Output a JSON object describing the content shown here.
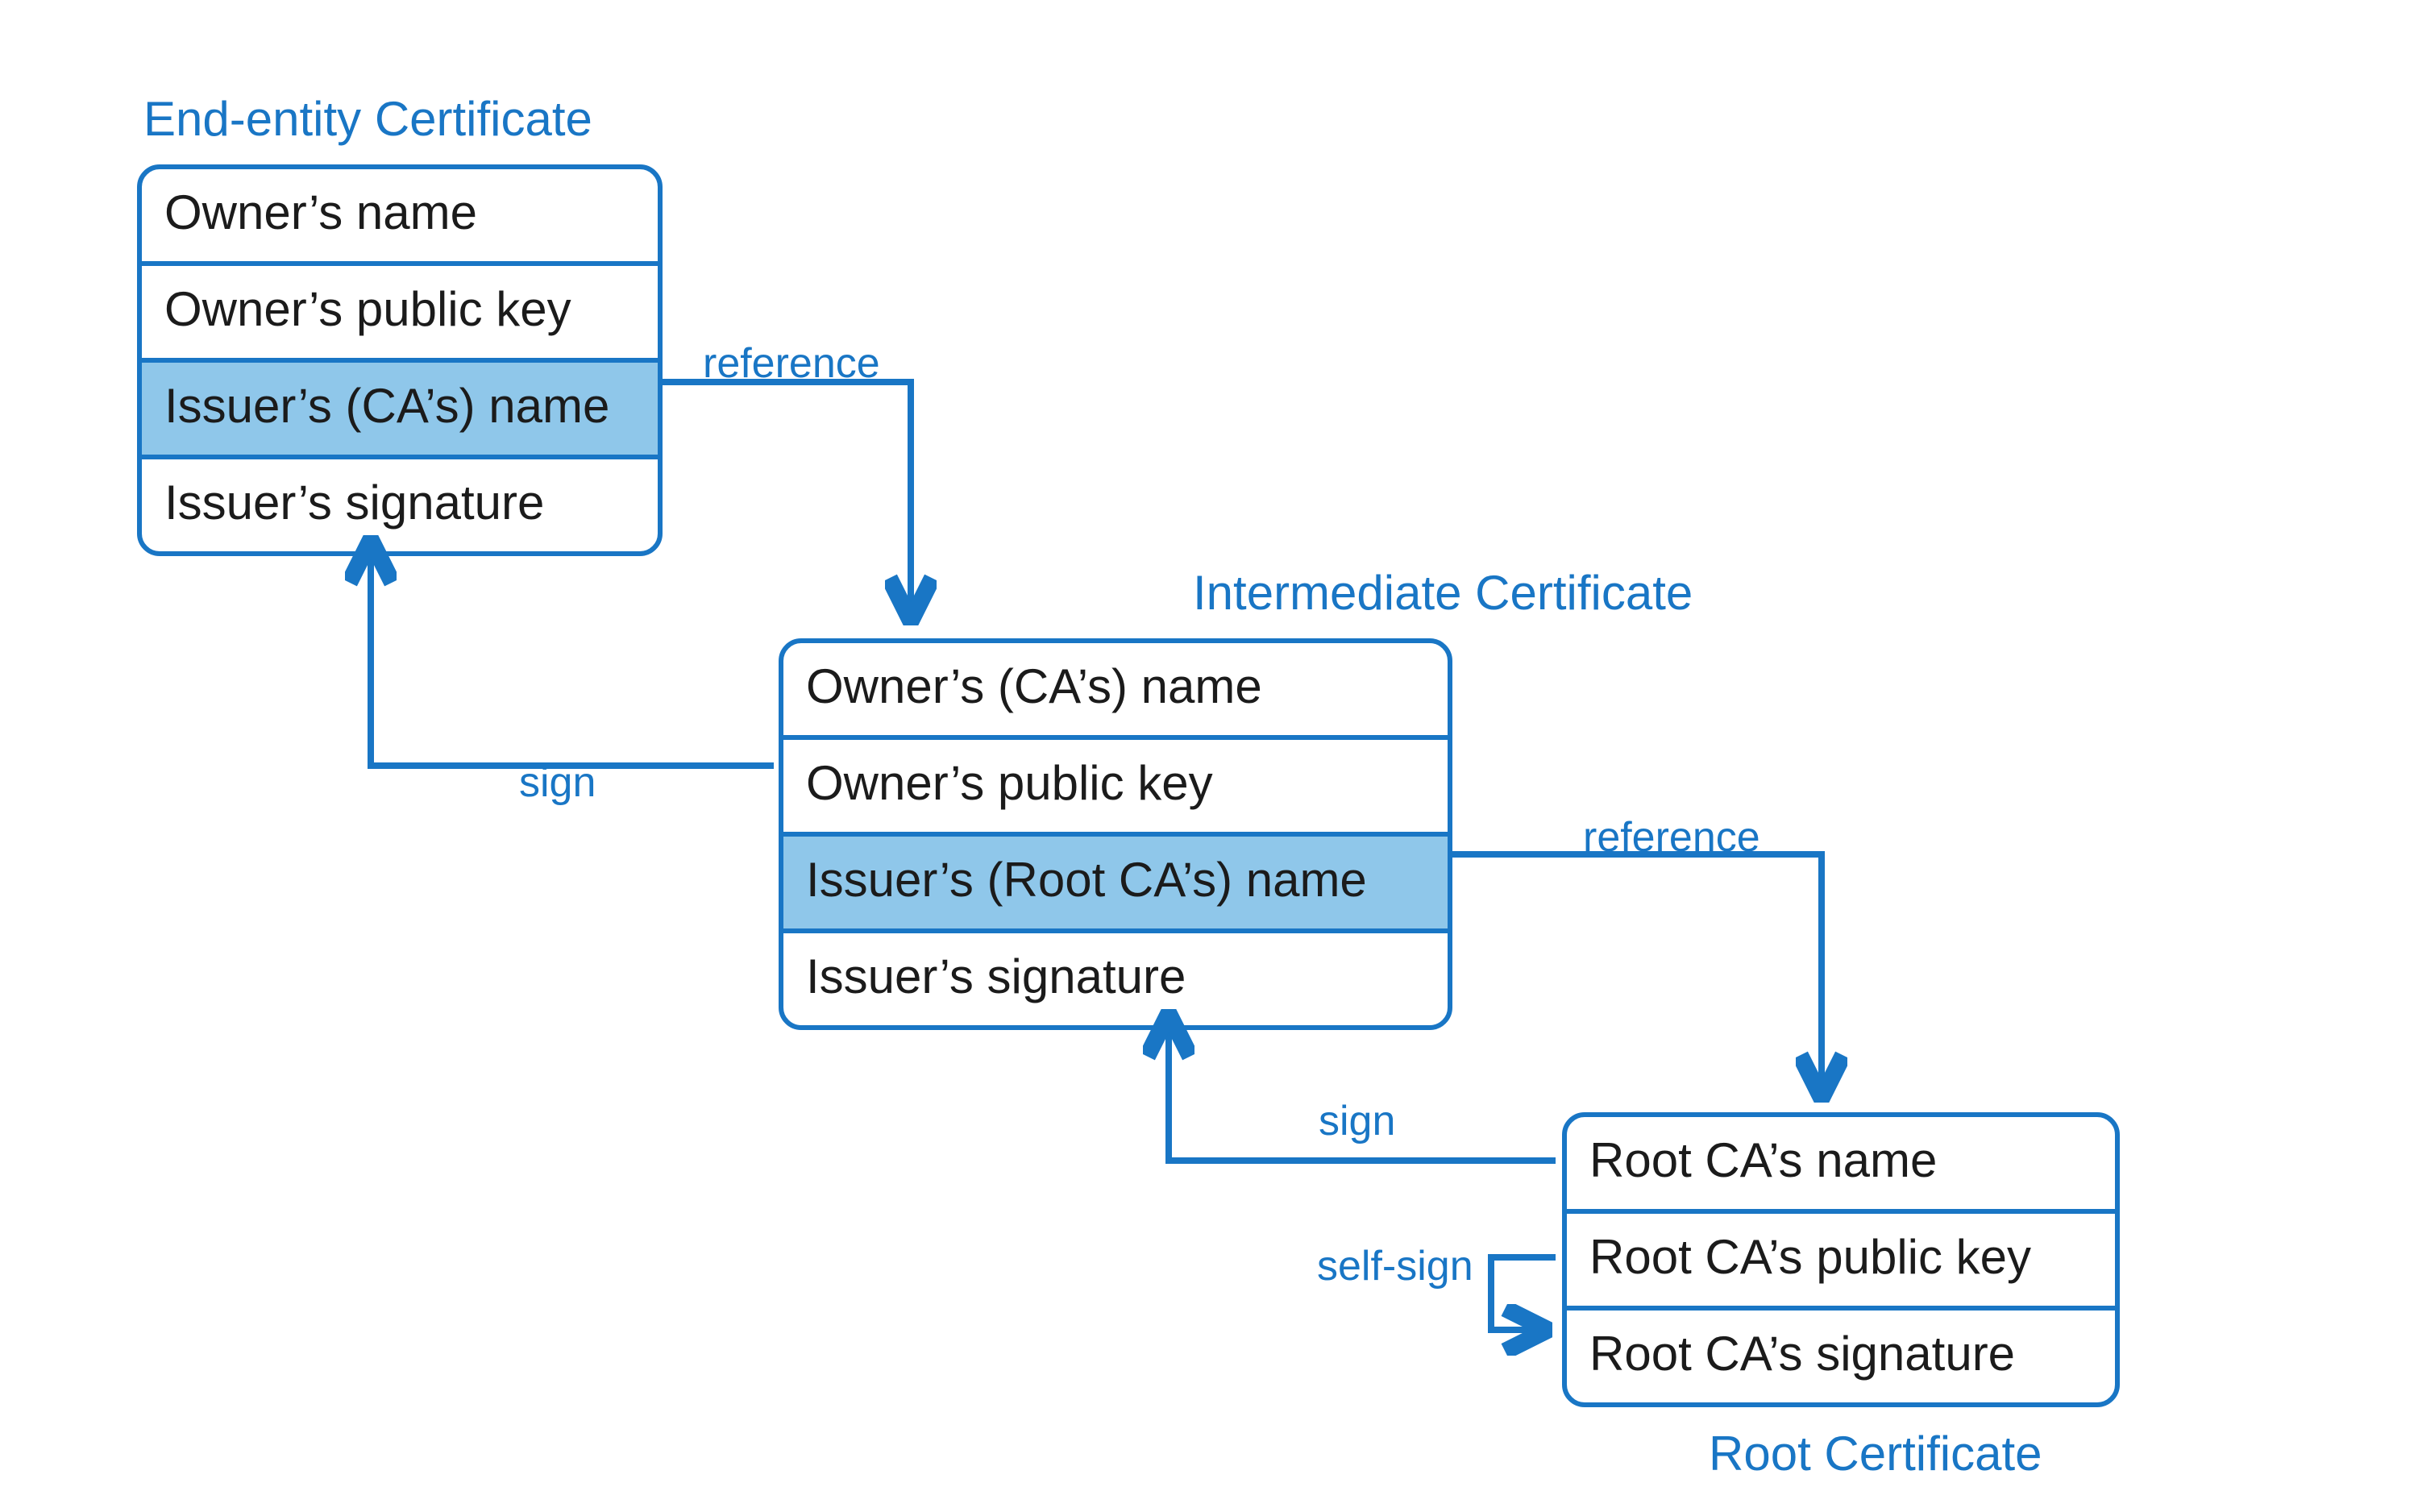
{
  "colors": {
    "accent": "#1976c5",
    "highlight": "#8fc7ea",
    "text": "#1b1b1b"
  },
  "certificates": {
    "end_entity": {
      "title": "End-entity Certificate",
      "rows": [
        "Owner’s name",
        "Owner’s public key",
        "Issuer’s (CA’s) name",
        "Issuer’s signature"
      ],
      "highlight_index": 2
    },
    "intermediate": {
      "title": "Intermediate Certificate",
      "rows": [
        "Owner’s (CA’s) name",
        "Owner’s public key",
        "Issuer’s (Root CA’s) name",
        "Issuer’s signature"
      ],
      "highlight_index": 2
    },
    "root": {
      "title": "Root Certificate",
      "rows": [
        "Root CA’s name",
        "Root CA’s public key",
        "Root CA’s signature"
      ],
      "highlight_index": -1
    }
  },
  "edges": {
    "ref1": "reference",
    "ref2": "reference",
    "sign1": "sign",
    "sign2": "sign",
    "selfsign": "self-sign"
  }
}
